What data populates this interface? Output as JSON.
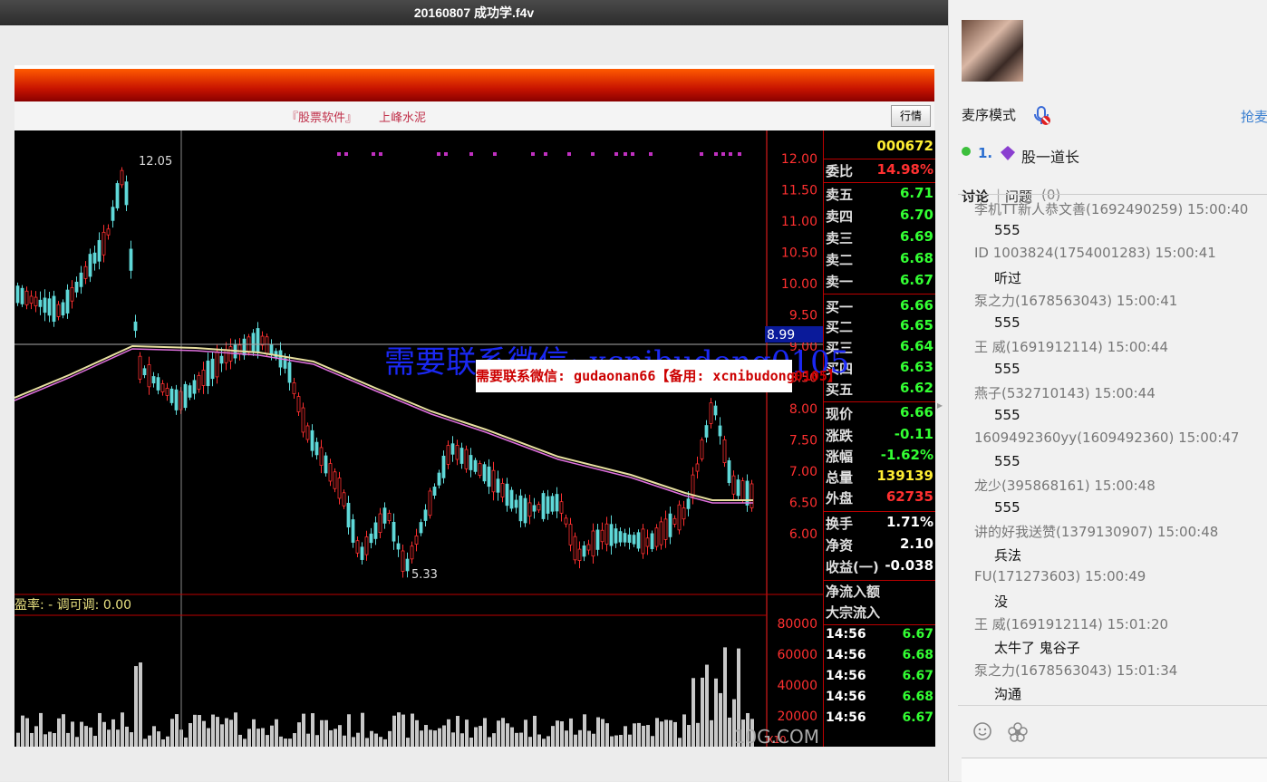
{
  "window": {
    "title": "20160807 成功学.f4v"
  },
  "toolbar": {
    "app_label": "『股票软件』",
    "stock_name": "上峰水泥",
    "quote_button": "行情"
  },
  "chart": {
    "code": "000672",
    "price_axis": [
      "12.00",
      "11.50",
      "11.00",
      "10.50",
      "10.00",
      "9.50",
      "9.00",
      "8.50",
      "8.00",
      "7.50",
      "7.00",
      "6.50",
      "6.00"
    ],
    "current_price_marker": "8.99",
    "high_label": "12.05",
    "low_label": "5.33",
    "indicator_label": "盈率: - 调可调: 0.00",
    "volume_axis": [
      "80000",
      "60000",
      "40000",
      "20000"
    ],
    "zoom_label": "X10",
    "site_watermark": "10G.COM",
    "overlay_watermark": "需要联系微信: xcnibudong0105",
    "banner": "需要联系微信: gudaonan66【备用: xcnibudong0105】",
    "colors": {
      "up": "#ff3030",
      "down": "#5fd8d8",
      "ma1": "#e8e0a0",
      "ma2": "#e070e0",
      "volume": "#c8c8c8",
      "axis": "#ff2020",
      "green": "#33ff33"
    }
  },
  "quote": {
    "weibi": {
      "label": "委比",
      "value": "14.98%"
    },
    "sell": [
      {
        "label": "卖五",
        "value": "6.71"
      },
      {
        "label": "卖四",
        "value": "6.70"
      },
      {
        "label": "卖三",
        "value": "6.69"
      },
      {
        "label": "卖二",
        "value": "6.68"
      },
      {
        "label": "卖一",
        "value": "6.67"
      }
    ],
    "buy": [
      {
        "label": "买一",
        "value": "6.66"
      },
      {
        "label": "买二",
        "value": "6.65"
      },
      {
        "label": "买三",
        "value": "6.64"
      },
      {
        "label": "买四",
        "value": "6.63"
      },
      {
        "label": "买五",
        "value": "6.62"
      }
    ],
    "stats": [
      {
        "label": "现价",
        "value": "6.66"
      },
      {
        "label": "涨跌",
        "value": "-0.11"
      },
      {
        "label": "涨幅",
        "value": "-1.62%"
      },
      {
        "label": "总量",
        "value": "139139"
      },
      {
        "label": "外盘",
        "value": "62735"
      }
    ],
    "stats2": [
      {
        "label": "换手",
        "value": "1.71%"
      },
      {
        "label": "净资",
        "value": "2.10"
      },
      {
        "label": "收益(一)",
        "value": "-0.038"
      }
    ],
    "flow": [
      "净流入额",
      "大宗流入"
    ],
    "ticks": [
      {
        "time": "14:56",
        "value": "6.67"
      },
      {
        "time": "14:56",
        "value": "6.68"
      },
      {
        "time": "14:56",
        "value": "6.67"
      },
      {
        "time": "14:56",
        "value": "6.68"
      },
      {
        "time": "14:56",
        "value": "6.67"
      }
    ]
  },
  "sidebar": {
    "mode_label": "麦序模式",
    "grab_label": "抢麦",
    "queue": {
      "index": "1.",
      "name": "股一道长"
    },
    "tabs": {
      "discuss": "讨论",
      "question": "问题",
      "question_count": "(0)"
    },
    "messages": [
      {
        "name": "李机TT新人恭文善(1692490259) 15:00:40",
        "text": "555"
      },
      {
        "name": "ID 1003824(1754001283) 15:00:41",
        "text": "听过"
      },
      {
        "name": "泵之力(1678563043) 15:00:41",
        "text": "555"
      },
      {
        "name": "王 威(1691912114) 15:00:44",
        "text": "555"
      },
      {
        "name": "燕子(532710143) 15:00:44",
        "text": "555"
      },
      {
        "name": "1609492360yy(1609492360) 15:00:47",
        "text": "555"
      },
      {
        "name": "龙少(395868161) 15:00:48",
        "text": "555"
      },
      {
        "name": "讲的好我送赞(1379130907) 15:00:48",
        "text": "兵法"
      },
      {
        "name": "FU(171273603) 15:00:49",
        "text": "没"
      },
      {
        "name": "王 威(1691912114) 15:01:20",
        "text": "太牛了  鬼谷子"
      },
      {
        "name": "泵之力(1678563043) 15:01:34",
        "text": "沟通"
      }
    ]
  }
}
